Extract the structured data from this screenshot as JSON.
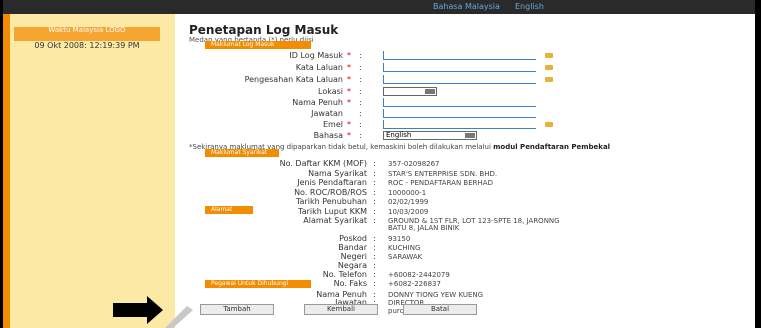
{
  "topbar": {
    "links": [
      "Bahasa Malaysia",
      "English"
    ]
  },
  "sidebar": {
    "waktu_label": "Waktu Malaysia LOGO",
    "waktu_value": "09 Okt 2008: 12:19:39 PM"
  },
  "page": {
    "title": "Penetapan Log Masuk",
    "note": "Medan yang bertanda (*) perlu diisi"
  },
  "section_login": {
    "header": "Maklumat Log Masuk",
    "fields": [
      {
        "label": "ID Log Masuk",
        "required": true,
        "kind": "text"
      },
      {
        "label": "Kata Laluan",
        "required": true,
        "kind": "text"
      },
      {
        "label": "Pengesahan Kata Laluan",
        "required": true,
        "kind": "text"
      },
      {
        "label": "Lokasi",
        "required": true,
        "kind": "select"
      },
      {
        "label": "Nama Penuh",
        "required": true,
        "kind": "text"
      },
      {
        "label": "Jawatan",
        "required": false,
        "kind": "text"
      },
      {
        "label": "Emel",
        "required": true,
        "kind": "text"
      },
      {
        "label": "Bahasa",
        "required": true,
        "kind": "select",
        "value": "English"
      }
    ]
  },
  "info_text_prefix": "*Sekiranya maklumat yang dipaparkan tidak betul, kemaskini boleh dilakukan melalui",
  "info_text_bold": "modul Pendaftaran Pembekal",
  "section_company": {
    "header": "Maklumat Syarikat",
    "rows": [
      {
        "label": "No. Daftar KKM (MOF)",
        "value": "357-02098267"
      },
      {
        "label": "Nama Syarikat",
        "value": "STAR'S ENTERPRISE SDN. BHD."
      },
      {
        "label": "Jenis Pendaftaran",
        "value": "ROC - PENDAFTARAN BERHAD"
      },
      {
        "label": "No. ROC/ROB/ROS",
        "value": "1000000-1"
      },
      {
        "label": "Tarikh Penubuhan",
        "value": "02/02/1999"
      },
      {
        "label": "Tarikh Luput KKM",
        "value": "10/03/2009"
      }
    ]
  },
  "section_address": {
    "header": "Alamat",
    "rows": [
      {
        "label": "Alamat Syarikat",
        "value": "GROUND & 1ST FLR, LOT 123-SPTE 18, JARONNG",
        "value2": "BATU 8, JALAN BINIK"
      },
      {
        "label": "Poskod",
        "value": "93150"
      },
      {
        "label": "Bandar",
        "value": "KUCHING"
      },
      {
        "label": "Negeri",
        "value": "SARAWAK"
      },
      {
        "label": "Negara",
        "value": ""
      },
      {
        "label": "No. Telefon",
        "value": "+60082-2442079"
      },
      {
        "label": "No. Faks",
        "value": "+6082-226837"
      }
    ]
  },
  "section_contact": {
    "header": "Pegawai Untuk Dihubungi",
    "rows": [
      {
        "label": "Nama Penuh",
        "value": "DONNY TIONG YEW KUENG"
      },
      {
        "label": "Jawatan",
        "value": "DIRECTOR"
      },
      {
        "label": "Emel",
        "value": "purchase@star.com"
      }
    ]
  },
  "buttons": [
    "Tambah",
    "Kembali",
    "Batal"
  ],
  "colors": {
    "accent": "#f28c00",
    "sidebar_bg": "#fde9a6"
  }
}
